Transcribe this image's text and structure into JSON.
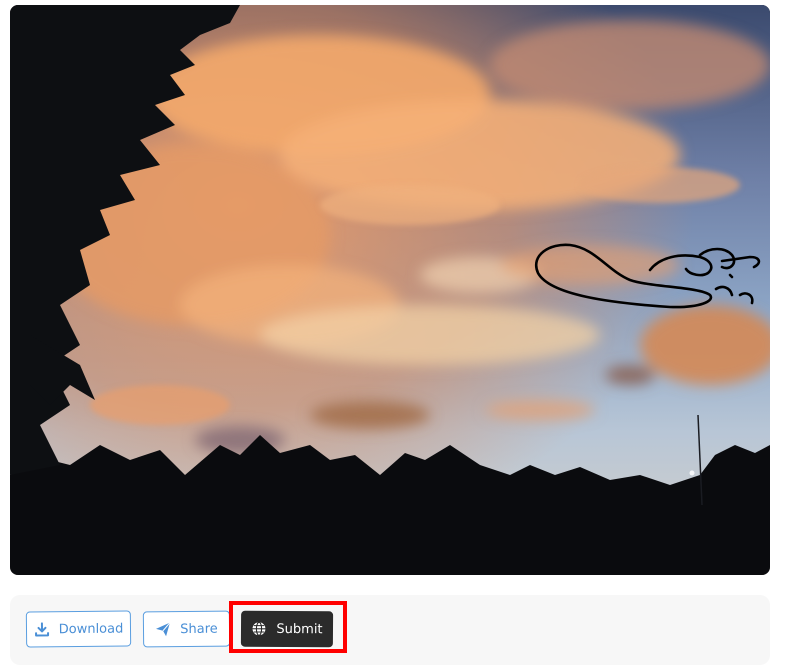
{
  "photo": {
    "subject": "sunset-sky-with-clouds-and-tree-silhouettes",
    "annotation": "hand-drawn-scribble"
  },
  "toolbar": {
    "download_label": "Download",
    "share_label": "Share",
    "submit_label": "Submit"
  },
  "icons": {
    "download": "download-icon",
    "share": "send-icon",
    "submit": "globe-icon"
  },
  "colors": {
    "outline_button": "#5a9ee0",
    "submit_button": "#2b2b2b",
    "highlight": "#ff0000"
  }
}
